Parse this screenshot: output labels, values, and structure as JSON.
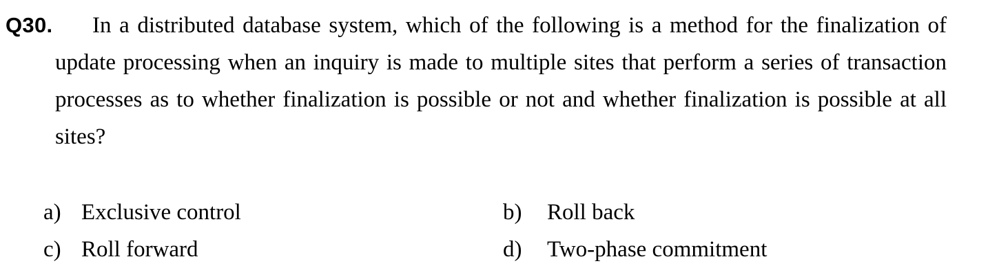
{
  "question": {
    "number": "Q30.",
    "text": "In a distributed database system, which of the following is a method for the finalization of update processing when an inquiry is made to multiple sites that perform a series of transaction processes as to whether finalization is possible or not and whether finalization is possible at all sites?"
  },
  "options": [
    {
      "letter": "a)",
      "text": "Exclusive control"
    },
    {
      "letter": "b)",
      "text": "Roll back"
    },
    {
      "letter": "c)",
      "text": "Roll forward"
    },
    {
      "letter": "d)",
      "text": "Two-phase commitment"
    }
  ]
}
